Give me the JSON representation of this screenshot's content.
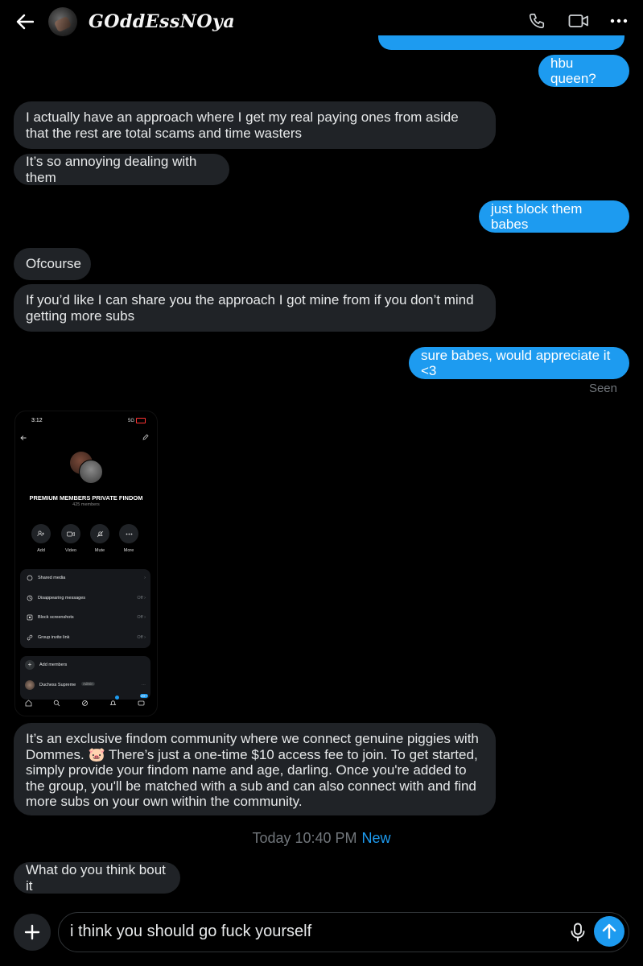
{
  "header": {
    "title": "GOddEssNOya",
    "icons": [
      "back-arrow-icon",
      "phone-icon",
      "video-call-icon",
      "more-icon"
    ]
  },
  "messages": [
    {
      "dir": "out",
      "text": "hbu queen?"
    },
    {
      "dir": "in",
      "text": "I actually have an approach where I get my real paying ones from aside that the rest are total scams and time wasters"
    },
    {
      "dir": "in",
      "text": "It’s so annoying dealing with them"
    },
    {
      "dir": "out",
      "text": "just block them babes"
    },
    {
      "dir": "in",
      "text": "Ofcourse"
    },
    {
      "dir": "in",
      "text": "If you’d like I can share you the approach I got mine from if you don’t mind getting more subs"
    },
    {
      "dir": "out",
      "text": "sure babes, would appreciate it <3"
    },
    {
      "dir": "in",
      "text": "It’s an exclusive findom community where we connect genuine piggies with Dommes. 🐷 There’s just a one-time $10 access fee to join. To get started, simply provide your findom name and age, darling. Once you're added to the group, you'll be matched with a sub and can also connect with and find more subs on your own within the community."
    },
    {
      "dir": "in",
      "text": "What do you think bout it"
    }
  ],
  "seen_label": "Seen",
  "timestamp": {
    "time": "Today 10:40 PM",
    "new_label": "New"
  },
  "screenshot": {
    "time": "3:12",
    "network": "5G",
    "group_name": "PREMIUM MEMBERS PRIVATE FINDOM",
    "members": "425 members",
    "actions": [
      "Add",
      "Video",
      "Mute",
      "More"
    ],
    "settings": [
      {
        "label": "Shared media",
        "value": ""
      },
      {
        "label": "Disappearing messages",
        "value": "Off"
      },
      {
        "label": "Block screenshots",
        "value": "Off"
      },
      {
        "label": "Group invite link",
        "value": "Off"
      }
    ],
    "add_members": "Add members",
    "member_name": "Duchess Supreme",
    "member_role": "Admin",
    "badge_count": "20+"
  },
  "composer": {
    "value": "i think you should go fuck yourself"
  },
  "colors": {
    "accent": "#1d9bf0",
    "incoming": "#202327",
    "background": "#000000"
  }
}
